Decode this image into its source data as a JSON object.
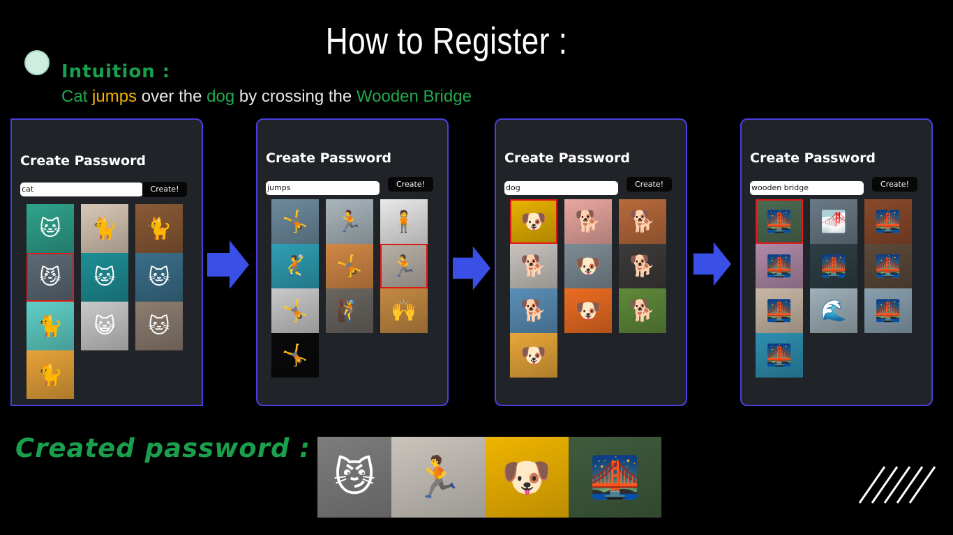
{
  "title": "How to Register :",
  "intuition": {
    "label": "Intuition :",
    "sentence": {
      "w1": "Cat",
      "w2": " ",
      "w3": "jumps",
      "w4": " over the ",
      "w5": "dog",
      "w6": " by crossing the ",
      "w7": "Wooden Bridge"
    }
  },
  "steps": [
    {
      "card_title": "Create Password",
      "input_value": "cat",
      "button": "Create!",
      "images": [
        {
          "motif": "🐱",
          "bg": "#2fa38c"
        },
        {
          "motif": "🐈",
          "bg": "#d8c7b4"
        },
        {
          "motif": "🐈",
          "bg": "#8a5a35"
        },
        {
          "motif": "😼",
          "bg": "#5c6a75",
          "selected": true
        },
        {
          "motif": "🐱",
          "bg": "#1d8f96"
        },
        {
          "motif": "🐱",
          "bg": "#3a6f8a"
        },
        {
          "motif": "🐈",
          "bg": "#5fd0c8"
        },
        {
          "motif": "😺",
          "bg": "#c9c9c9"
        },
        {
          "motif": "🐱",
          "bg": "#8d7d70"
        },
        {
          "motif": "🐈",
          "bg": "#e7a23a"
        }
      ]
    },
    {
      "card_title": "Create Password",
      "input_value": "jumps",
      "button": "Create!",
      "images": [
        {
          "motif": "🤸",
          "bg": "#6d8b9e"
        },
        {
          "motif": "🏃",
          "bg": "#a9b6bc"
        },
        {
          "motif": "🧍",
          "bg": "#e9e9e9"
        },
        {
          "motif": "🤾",
          "bg": "#2f9fb4"
        },
        {
          "motif": "🤸",
          "bg": "#d28846"
        },
        {
          "motif": "🏃",
          "bg": "#b7b0a6",
          "selected": true
        },
        {
          "motif": "🤸",
          "bg": "#c9c9c9"
        },
        {
          "motif": "🧗",
          "bg": "#6a6660"
        },
        {
          "motif": "🙌",
          "bg": "#c48a43"
        },
        {
          "motif": "🤸",
          "bg": "#0a0a0a"
        }
      ]
    },
    {
      "card_title": "Create Password",
      "input_value": "dog",
      "button": "Create!",
      "images": [
        {
          "motif": "🐶",
          "bg": "#e8b200",
          "selected": true
        },
        {
          "motif": "🐕",
          "bg": "#e9a7a0"
        },
        {
          "motif": "🐕",
          "bg": "#b86a3b"
        },
        {
          "motif": "🐕",
          "bg": "#c8c3be"
        },
        {
          "motif": "🐶",
          "bg": "#7d8c94"
        },
        {
          "motif": "🐕",
          "bg": "#3d3a3a"
        },
        {
          "motif": "🐕",
          "bg": "#5a8fb8"
        },
        {
          "motif": "🐶",
          "bg": "#ec6d22"
        },
        {
          "motif": "🐕",
          "bg": "#5f8a3a"
        },
        {
          "motif": "🐶",
          "bg": "#e8a73a"
        }
      ]
    },
    {
      "card_title": "Create Password",
      "input_value": "wooden bridge",
      "button": "Create!",
      "images": [
        {
          "motif": "🌉",
          "bg": "#4d6b52",
          "selected": true
        },
        {
          "motif": "🌁",
          "bg": "#6a7a86"
        },
        {
          "motif": "🌉",
          "bg": "#8a4a2a"
        },
        {
          "motif": "🌉",
          "bg": "#b08aa8"
        },
        {
          "motif": "🌉",
          "bg": "#2d3f44"
        },
        {
          "motif": "🌉",
          "bg": "#5c4a3a"
        },
        {
          "motif": "🌉",
          "bg": "#c9b8a6"
        },
        {
          "motif": "🌊",
          "bg": "#9fb0b8"
        },
        {
          "motif": "🌉",
          "bg": "#8aa0b0"
        },
        {
          "motif": "🌉",
          "bg": "#2e8fb0"
        }
      ]
    }
  ],
  "created": {
    "label": "Created password :",
    "pieces": [
      {
        "motif": "😼",
        "bg": "#7d7d7d",
        "width": 106
      },
      {
        "motif": "🏃",
        "bg": "#c9c4bc",
        "width": 134
      },
      {
        "motif": "🐶",
        "bg": "#f0b400",
        "width": 120
      },
      {
        "motif": "🌉",
        "bg": "#3f5b3c",
        "width": 133
      }
    ]
  },
  "colors": {
    "accent_green": "#1aa04d",
    "accent_yellow": "#f5b301",
    "card_border": "#4b3ee0",
    "arrow": "#3a4fe6",
    "selected": "#e01818"
  }
}
